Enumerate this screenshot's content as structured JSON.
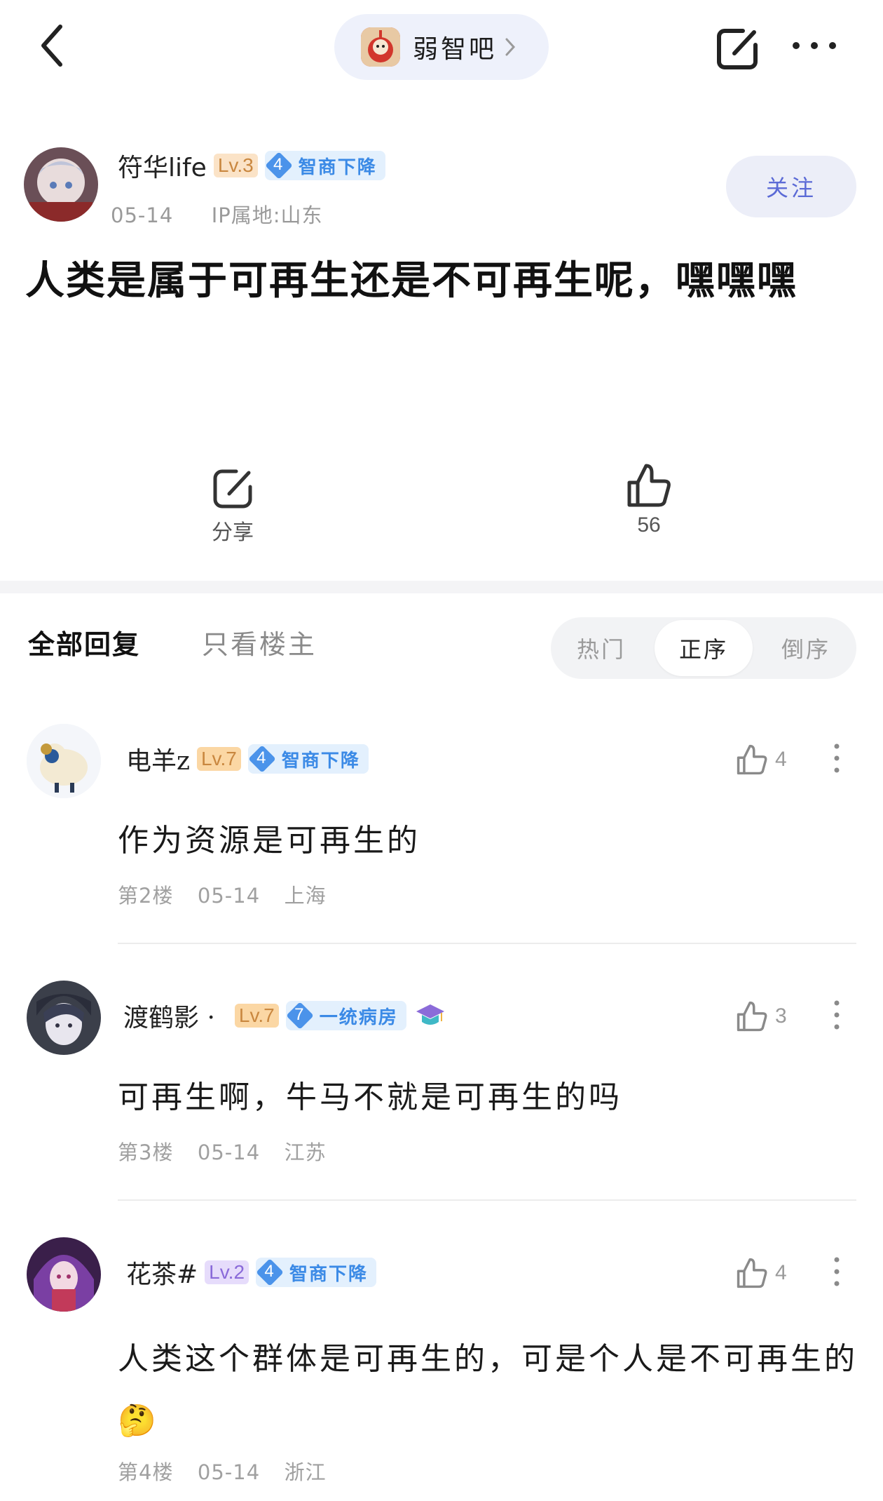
{
  "header": {
    "forum_name": "弱智吧"
  },
  "post": {
    "author": {
      "name": "符华life",
      "level": "Lv.3",
      "rank_num": "4",
      "rank_title": "智商下降",
      "date": "05-14",
      "ip_location": "IP属地:山东"
    },
    "follow_label": "关注",
    "title": "人类是属于可再生还是不可再生呢，嘿嘿嘿",
    "share_label": "分享",
    "like_count": "56"
  },
  "replies_header": {
    "tab_all": "全部回复",
    "tab_op_only": "只看楼主",
    "sort_hot": "热门",
    "sort_asc": "正序",
    "sort_desc": "倒序",
    "active_sort": "正序"
  },
  "comments": [
    {
      "name": "电羊z",
      "level": "Lv.7",
      "rank_num": "4",
      "rank_title": "智商下降",
      "text": "作为资源是可再生的",
      "floor": "第2楼",
      "date": "05-14",
      "location": "上海",
      "likes": "4"
    },
    {
      "name": "渡鹤影 ·",
      "level": "Lv.7",
      "rank_num": "7",
      "rank_title": "一统病房",
      "text": "可再生啊，牛马不就是可再生的吗",
      "floor": "第3楼",
      "date": "05-14",
      "location": "江苏",
      "likes": "3"
    },
    {
      "name": "花茶#",
      "level": "Lv.2",
      "rank_num": "4",
      "rank_title": "智商下降",
      "text": "人类这个群体是可再生的，可是个人是不可再生的🤔",
      "floor": "第4楼",
      "date": "05-14",
      "location": "浙江",
      "likes": "4"
    }
  ],
  "colors": {
    "accent": "#5b6ad6",
    "rank_blue": "#4b93ea",
    "lv3_bg": "#fbe3c7",
    "lv7_bg": "#fbd7a4",
    "lv2_bg": "#e6dcfb"
  }
}
